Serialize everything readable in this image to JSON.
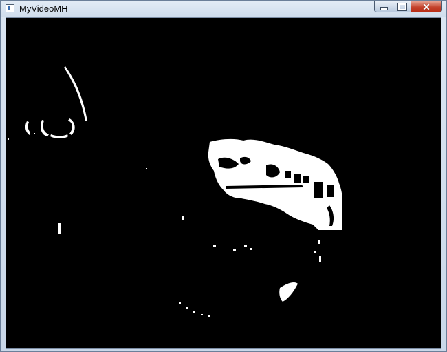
{
  "window": {
    "title": "MyVideoMH",
    "icon": "app-window-icon"
  },
  "controls": {
    "minimize_icon": "minimize-icon",
    "maximize_icon": "maximize-icon",
    "close_icon": "close-icon",
    "close_glyph": "✕"
  },
  "colors": {
    "frame_background": "#000000",
    "mask_foreground": "#ffffff",
    "close_button": "#c4432d"
  }
}
